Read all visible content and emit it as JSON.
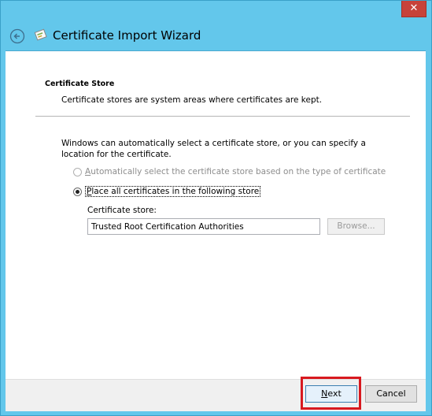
{
  "window": {
    "title": "Certificate Import Wizard",
    "close_glyph": "✕"
  },
  "section": {
    "title": "Certificate Store",
    "description": "Certificate stores are system areas where certificates are kept."
  },
  "intro": "Windows can automatically select a certificate store, or you can specify a location for the certificate.",
  "options": {
    "auto": {
      "accel": "A",
      "rest": "utomatically select the certificate store based on the type of certificate",
      "checked": false,
      "enabled": false
    },
    "place": {
      "accel": "P",
      "rest": "lace all certificates in the following store",
      "checked": true,
      "enabled": true
    }
  },
  "store": {
    "label": "Certificate store:",
    "value": "Trusted Root Certification Authorities",
    "browse_accel": "R",
    "browse_label": "Browse..."
  },
  "buttons": {
    "next_accel": "N",
    "next_rest": "ext",
    "cancel": "Cancel"
  },
  "icons": {
    "back": "back-arrow-icon",
    "wizard": "certificate-icon"
  },
  "colors": {
    "chrome": "#63c7eb",
    "close": "#c7423a",
    "highlight": "#d8191f"
  }
}
